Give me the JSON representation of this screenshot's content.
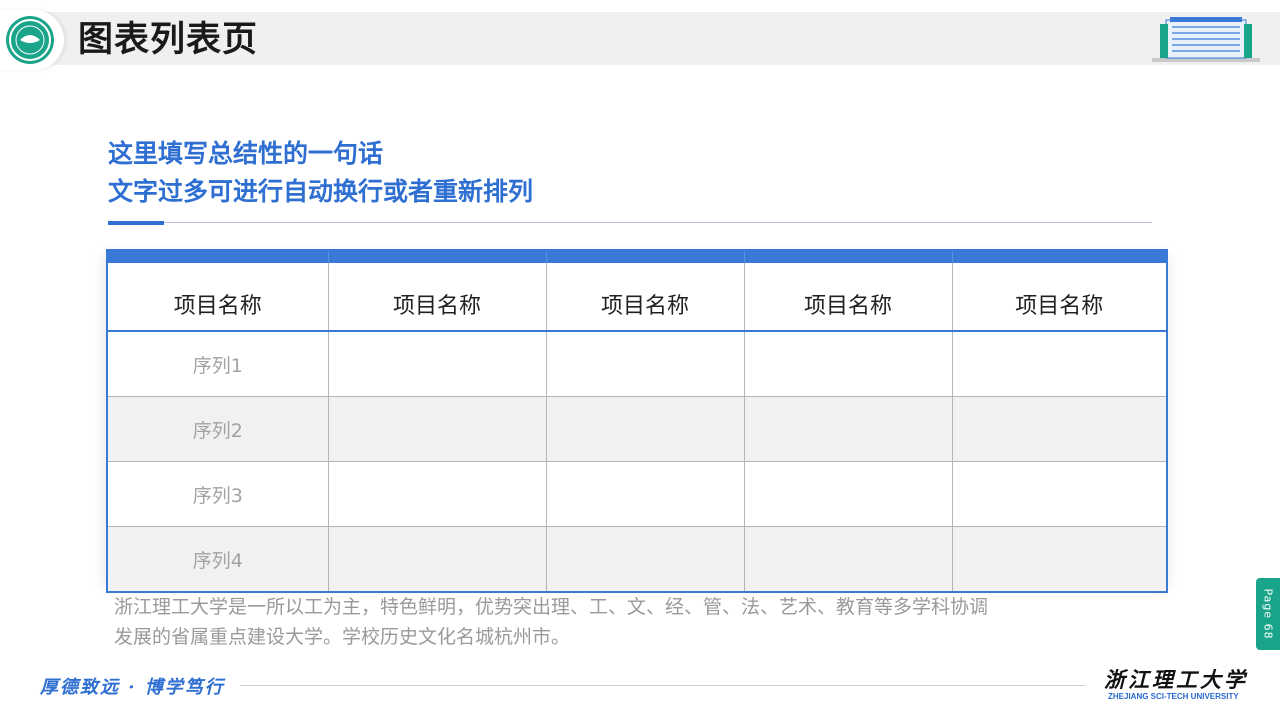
{
  "header": {
    "title": "图表列表页"
  },
  "headline": {
    "line1": "这里填写总结性的一句话",
    "line2": "文字过多可进行自动换行或者重新排列"
  },
  "table": {
    "columns": [
      "项目名称",
      "项目名称",
      "项目名称",
      "项目名称",
      "项目名称"
    ],
    "rows": [
      "序列1",
      "序列2",
      "序列3",
      "序列4"
    ]
  },
  "description": {
    "line1": "浙江理工大学是一所以工为主，特色鲜明，优势突出理、工、文、经、管、法、艺术、教育等多学科协调",
    "line2": "发展的省属重点建设大学。学校历史文化名城杭州市。"
  },
  "page_tab": {
    "label": "Page 68"
  },
  "footer": {
    "motto": "厚德致远 · 博学笃行",
    "university_cn": "浙江理工大学",
    "university_en": "ZHEJIANG SCI-TECH UNIVERSITY"
  },
  "colors": {
    "accent_blue": "#3a79d7",
    "brand_green": "#1aa58a"
  },
  "icons": {
    "logo": "university-seal-icon",
    "building": "campus-building-icon"
  }
}
